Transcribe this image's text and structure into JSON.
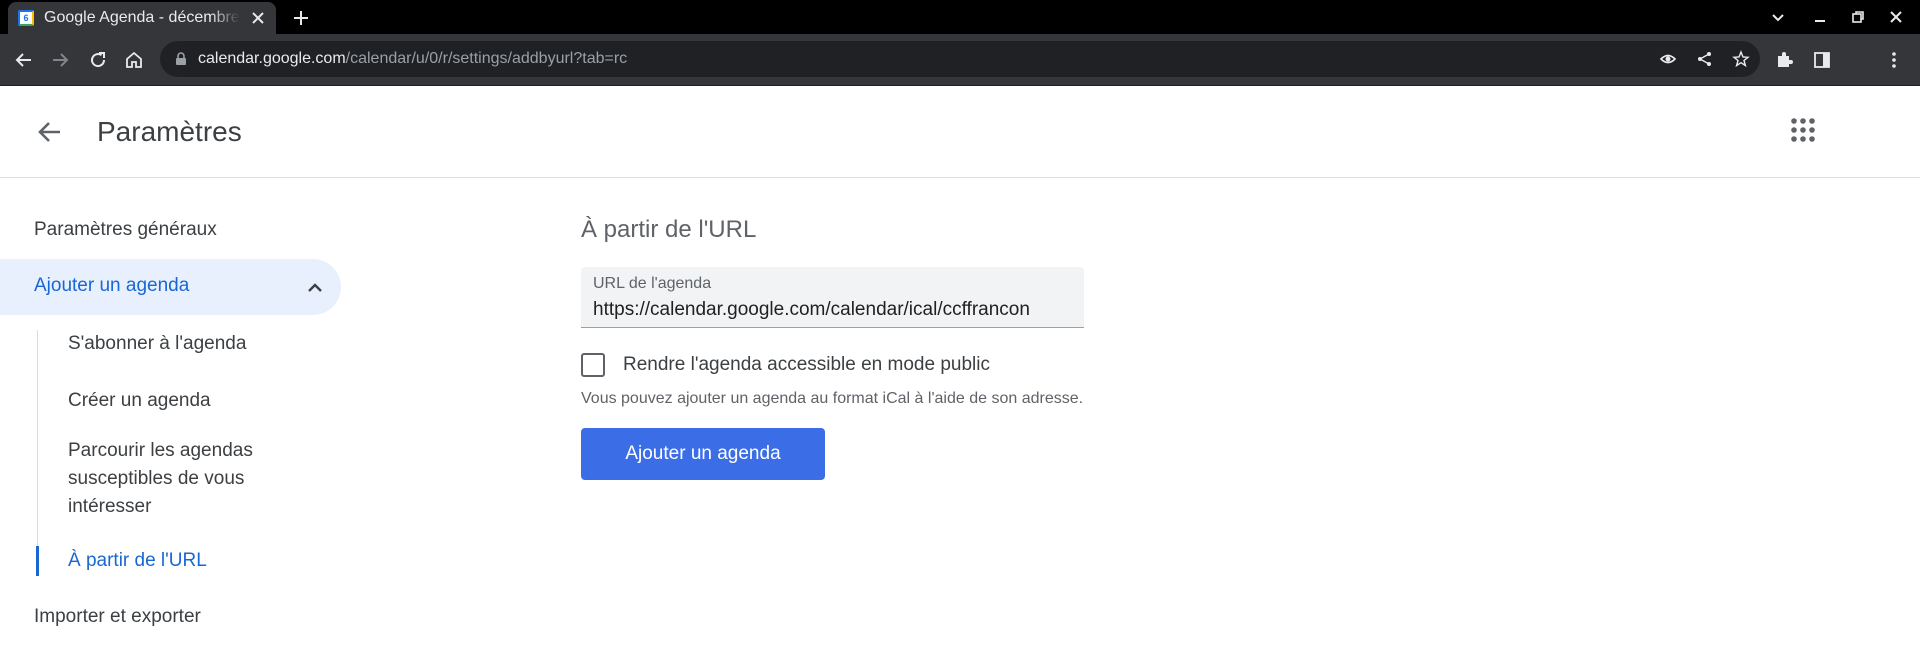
{
  "browser": {
    "tab_title": "Google Agenda - décembre",
    "favicon_text": "6",
    "url_host": "calendar.google.com",
    "url_path": "/calendar/u/0/r/settings/addbyurl?tab=rc"
  },
  "header": {
    "title": "Paramètres"
  },
  "sidebar": {
    "general": "Paramètres généraux",
    "add_calendar": "Ajouter un agenda",
    "sub_items": [
      "S'abonner à l'agenda",
      "Créer un agenda",
      "Parcourir les agendas susceptibles de vous intéresser",
      "À partir de l'URL"
    ],
    "import_export": "Importer et exporter"
  },
  "main": {
    "section_title": "À partir de l'URL",
    "url_field_label": "URL de l'agenda",
    "url_field_value": "https://calendar.google.com/calendar/ical/ccffrancon",
    "public_checkbox_label": "Rendre l'agenda accessible en mode public",
    "public_checked": false,
    "helper_text": "Vous pouvez ajouter un agenda au format iCal à l'aide de son adresse.",
    "add_button": "Ajouter un agenda"
  },
  "colors": {
    "accent": "#1967d2",
    "button": "#3b6ee6",
    "active_nav_bg": "#e8f0fe"
  }
}
